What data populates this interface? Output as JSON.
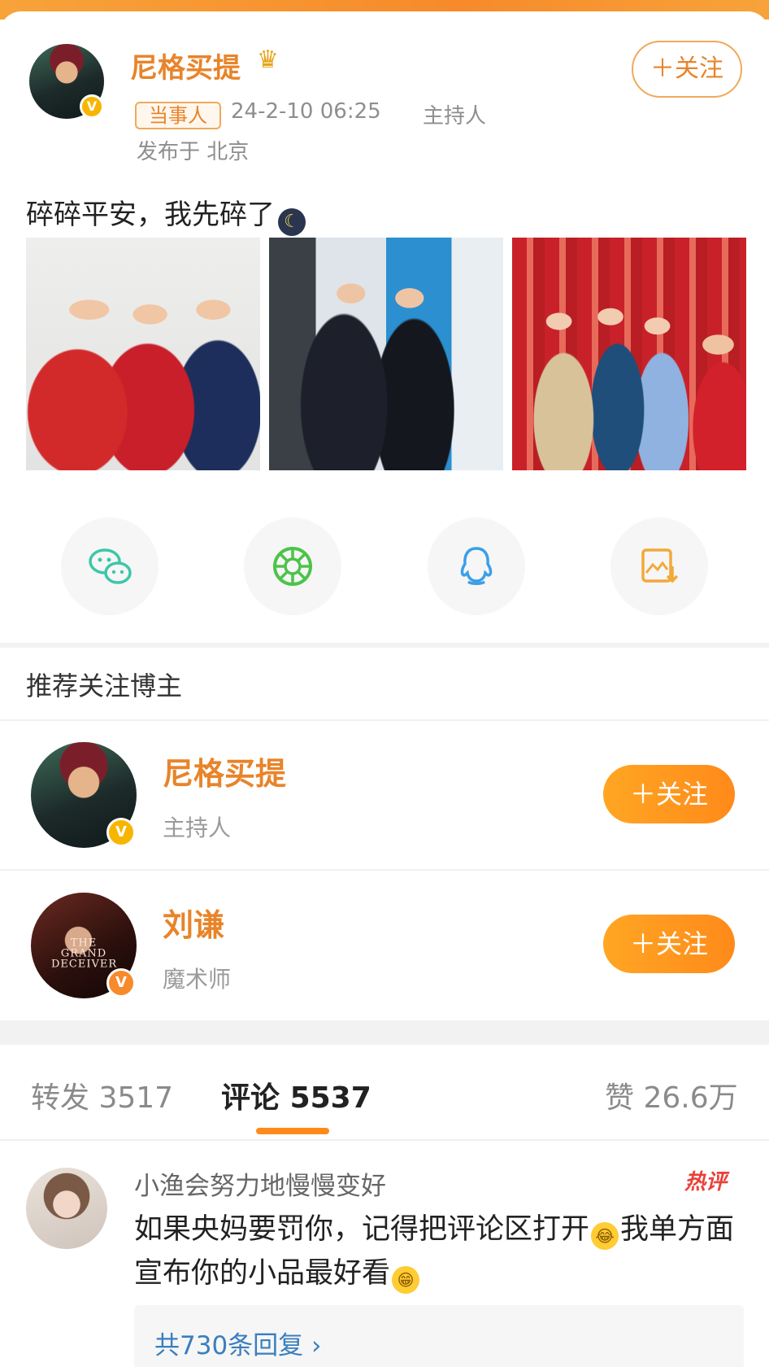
{
  "post": {
    "author": {
      "name": "尼格买提",
      "tag": "当事人",
      "time": "24-2-10 06:25",
      "role": "主持人",
      "location": "发布于 北京"
    },
    "follow_label": "＋关注",
    "text": "碎碎平安，我先碎了"
  },
  "share": {
    "items": [
      {
        "icon": "wechat-icon"
      },
      {
        "icon": "moments-icon"
      },
      {
        "icon": "qq-icon"
      },
      {
        "icon": "save-image-icon"
      }
    ]
  },
  "recommend": {
    "title": "推荐关注博主",
    "users": [
      {
        "name": "尼格买提",
        "desc": "主持人",
        "follow_label": "＋关注"
      },
      {
        "name": "刘谦",
        "desc": "魔术师",
        "follow_label": "＋关注",
        "avatar_text": "THE GRAND DECEIVER"
      }
    ]
  },
  "stats": {
    "repost_label": "转发",
    "repost_count": "3517",
    "comment_label": "评论",
    "comment_count": "5537",
    "like_label": "赞",
    "like_count": "26.6万"
  },
  "comment": {
    "user": "小渔会努力地慢慢变好",
    "hot_label": "热评",
    "text_part1": "如果央妈要罚你，记得把评论区打开",
    "text_part2": "我单方面宣布你的小品最好看",
    "replies_label": "共730条回复 ›"
  },
  "colors": {
    "accent": "#e8842a",
    "follow_button": "#ff8a1a",
    "link": "#3a7ebf",
    "hot": "#e8413a"
  }
}
